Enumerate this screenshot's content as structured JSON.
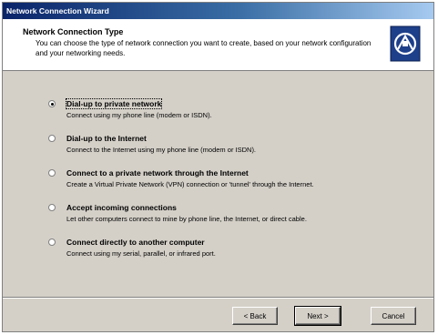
{
  "window": {
    "title": "Network Connection Wizard"
  },
  "header": {
    "title": "Network Connection Type",
    "description": "You can choose the type of network connection you want to create, based on your network configuration and your networking needs.",
    "icon": "network-wizard-icon"
  },
  "options": [
    {
      "label": "Dial-up to private network",
      "description": "Connect using my phone line (modem or ISDN).",
      "checked": true
    },
    {
      "label": "Dial-up to the Internet",
      "description": "Connect to the Internet using my phone line (modem or ISDN).",
      "checked": false
    },
    {
      "label": "Connect to a private network through the Internet",
      "description": "Create a Virtual Private Network (VPN) connection or 'tunnel' through the Internet.",
      "checked": false
    },
    {
      "label": "Accept incoming connections",
      "description": "Let other computers connect to mine by phone line, the Internet, or direct cable.",
      "checked": false
    },
    {
      "label": "Connect directly to another computer",
      "description": "Connect using my serial, parallel, or infrared port.",
      "checked": false
    }
  ],
  "buttons": {
    "back": "< Back",
    "next": "Next >",
    "cancel": "Cancel"
  }
}
